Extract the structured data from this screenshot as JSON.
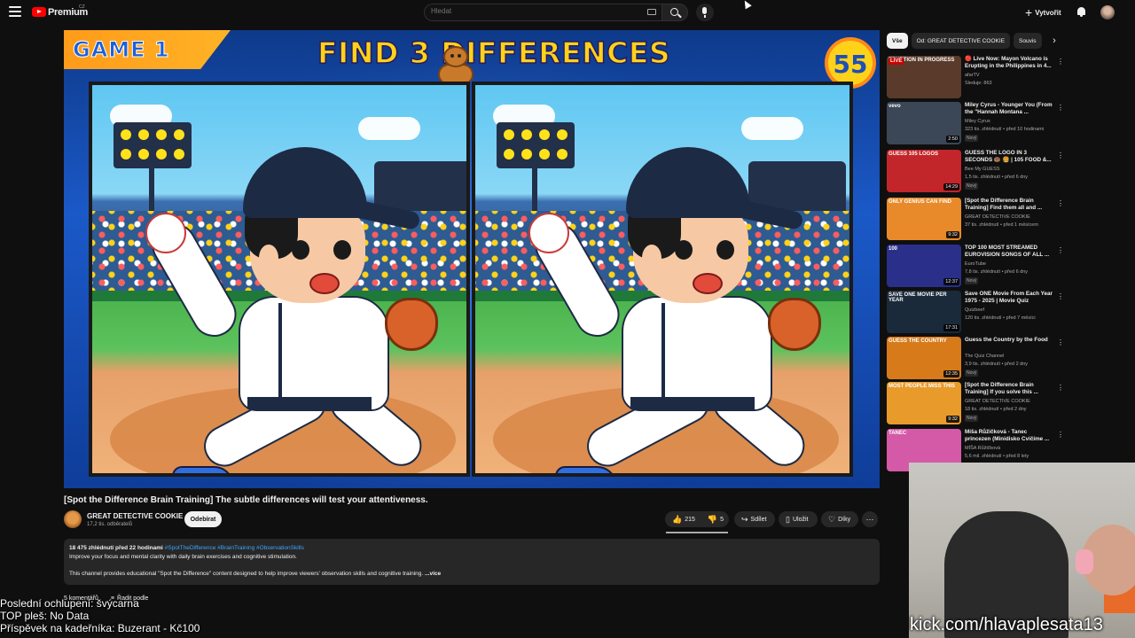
{
  "header": {
    "brand": "Premium",
    "country": "CZ",
    "search_placeholder": "Hledat",
    "create_label": "Vytvořit"
  },
  "video": {
    "overlay": {
      "game_label": "GAME 1",
      "title": "FIND 3 DIFFERENCES",
      "timer": "55"
    },
    "title": "[Spot the Difference Brain Training] The subtle differences will test your attentiveness.",
    "channel": "GREAT DETECTIVE COOKIE",
    "subscribers": "17,2 tis. odběratelů",
    "subscribe_label": "Odebírat",
    "likes": "215",
    "comments_count": "5",
    "share_label": "Sdílet",
    "save_label": "Uložit",
    "thanks_label": "Díky",
    "description": {
      "stats": "18 475 zhlédnutí  před 22 hodinami",
      "tags": "#SpotTheDifference #BrainTraining #ObservationSkills",
      "line1": "Improve your focus and mental clarity with daily brain exercises and cognitive stimulation.",
      "line2": "This channel provides educational \"Spot the Difference\" content designed to help improve viewers' observation skills and cognitive training.",
      "more": "...více"
    },
    "comments_label": "5 komentářů",
    "sort_label": "Řadit podle"
  },
  "sidebar": {
    "chips": [
      "Vše",
      "Od: GREAT DETECTIVE COOKIE",
      "Souvis"
    ],
    "items": [
      {
        "title": "🔴 Live Now: Mayon Volcano is Erupting in the Philippines in 4...",
        "channel": "afarTV",
        "meta": "Sleduje: 863",
        "badge": "",
        "duration": "",
        "live": "LIVE",
        "thumb_text": "ERUPTION IN PROGRESS",
        "thumb_color": "#5a3a2a"
      },
      {
        "title": "Miley Cyrus - Younger You (From the \"Hannah Montana ...",
        "channel": "Miley Cyrus",
        "meta": "323 tis. zhlédnutí • před 10 hodinami",
        "badge": "Nový",
        "duration": "2:50",
        "live": "",
        "thumb_text": "vevo",
        "thumb_color": "#3b4656"
      },
      {
        "title": "GUESS THE LOGO IN 3 SECONDS 🍩 🍔 | 105 FOOD &...",
        "channel": "Bee My GUESS",
        "meta": "1,5 tis. zhlédnutí • před 6 dny",
        "badge": "Nový",
        "duration": "14:29",
        "live": "",
        "thumb_text": "GUESS 105 LOGOS",
        "thumb_color": "#c3262a"
      },
      {
        "title": "[Spot the Difference Brain Training] Find them all and ...",
        "channel": "GREAT DETECTIVE COOKIE",
        "meta": "37 tis. zhlédnutí • před 1 měsícem",
        "badge": "",
        "duration": "9:32",
        "live": "",
        "thumb_text": "ONLY GENIUS CAN FIND",
        "thumb_color": "#e88a2a"
      },
      {
        "title": "TOP 100 MOST STREAMED EUROVISION SONGS OF ALL ...",
        "channel": "EuroTube",
        "meta": "7,8 tis. zhlédnutí • před 6 dny",
        "badge": "Nový",
        "duration": "12:37",
        "live": "",
        "thumb_text": "100",
        "thumb_color": "#2a2f8a"
      },
      {
        "title": "Save ONE Movie From Each Year 1975 - 2025 | Movie Quiz",
        "channel": "Quizbeef",
        "meta": "120 tis. zhlédnutí • před 7 měsíci",
        "badge": "",
        "duration": "17:31",
        "live": "",
        "thumb_text": "SAVE ONE MOVIE PER YEAR",
        "thumb_color": "#1a2a3a"
      },
      {
        "title": "Guess the Country by the Food",
        "channel": "The Quiz Channel",
        "meta": "3,9 tis. zhlédnutí • před 2 dny",
        "badge": "Nový",
        "duration": "12:35",
        "live": "",
        "thumb_text": "GUESS THE COUNTRY",
        "thumb_color": "#d77a1a"
      },
      {
        "title": "[Spot the Difference Brain Training] If you solve this ...",
        "channel": "GREAT DETECTIVE COOKIE",
        "meta": "18 tis. zhlédnutí • před 2 dny",
        "badge": "Nový",
        "duration": "9:32",
        "live": "",
        "thumb_text": "MOST PEOPLE MISS THIS",
        "thumb_color": "#e89a2a"
      },
      {
        "title": "Míša Růžičková - Tanec princezen (Minidisko Cvičíme ...",
        "channel": "MÍŠA Růžičková",
        "meta": "5,6 mil. zhlédnutí • před 8 lety",
        "badge": "",
        "duration": "",
        "live": "",
        "thumb_text": "TANEC",
        "thumb_color": "#d45aa8"
      }
    ]
  },
  "overlay_text": {
    "line1": "Poslední ochlupení: švýcarna",
    "line2": "TOP pleš: No Data",
    "line3": "Příspěvek na kadeřníka: Buzerant - Kč100"
  },
  "stream_url": "kick.com/hlavaplesata13"
}
